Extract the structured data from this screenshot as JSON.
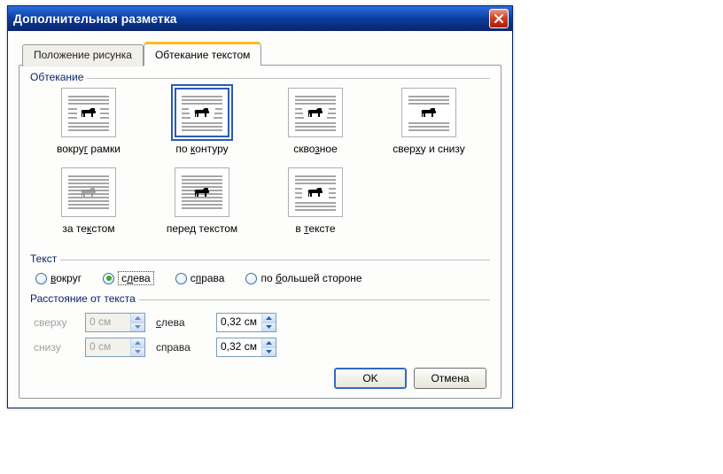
{
  "window": {
    "title": "Дополнительная разметка"
  },
  "tabs": [
    {
      "label": "Положение рисунка",
      "active": false
    },
    {
      "label": "Обтекание текстом",
      "active": true
    }
  ],
  "wrap_section": {
    "legend": "Обтекание",
    "options": [
      {
        "label": "вокруг рамки",
        "accel": "г",
        "selected": false,
        "icon": "square"
      },
      {
        "label": "по контуру",
        "accel": "к",
        "selected": true,
        "icon": "tight"
      },
      {
        "label": "сквозное",
        "accel": "з",
        "selected": false,
        "icon": "through"
      },
      {
        "label": "сверху и снизу",
        "accel": "х",
        "selected": false,
        "icon": "topbottom"
      },
      {
        "label": "за текстом",
        "accel": "к",
        "selected": false,
        "icon": "behind"
      },
      {
        "label": "перед текстом",
        "accel": "",
        "selected": false,
        "icon": "front"
      },
      {
        "label": "в тексте",
        "accel": "т",
        "selected": false,
        "icon": "inline"
      }
    ]
  },
  "text_section": {
    "legend": "Текст",
    "options": [
      {
        "label": "вокруг",
        "accel": "в",
        "selected": false
      },
      {
        "label": "слева",
        "accel": "л",
        "selected": true
      },
      {
        "label": "справа",
        "accel": "п",
        "selected": false
      },
      {
        "label": "по большей стороне",
        "accel": "б",
        "selected": false
      }
    ]
  },
  "distance_section": {
    "legend": "Расстояние от текста",
    "rows": {
      "top": {
        "label": "сверху",
        "value": "0 см",
        "enabled": false
      },
      "bottom": {
        "label": "снизу",
        "value": "0 см",
        "enabled": false
      },
      "left": {
        "label": "слева",
        "value": "0,32 см",
        "enabled": true,
        "accel": "с"
      },
      "right": {
        "label": "справа",
        "value": "0,32 см",
        "enabled": true
      }
    }
  },
  "buttons": {
    "ok": "OK",
    "cancel": "Отмена"
  }
}
